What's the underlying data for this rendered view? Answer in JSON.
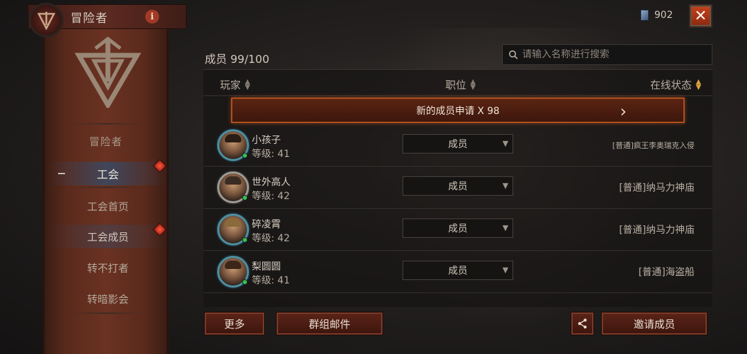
{
  "header": {
    "title": "冒险者",
    "info_icon": "info-icon"
  },
  "currency": {
    "icon": "gem-icon",
    "amount": "902"
  },
  "close_button": {
    "icon": "close-icon",
    "label": "✕"
  },
  "sidebar": {
    "caption": "冒险者",
    "items": [
      {
        "label": "工会",
        "state": "active",
        "badge": true
      },
      {
        "label": "工会首页",
        "state": "normal",
        "badge": false
      },
      {
        "label": "工会成员",
        "state": "selected",
        "badge": true
      },
      {
        "label": "转不打者",
        "state": "normal",
        "badge": false
      },
      {
        "label": "转暗影会",
        "state": "normal",
        "badge": false
      }
    ]
  },
  "members": {
    "count_label": "成员 99/100",
    "search_placeholder": "请输入名称进行搜索",
    "columns": {
      "player": "玩家",
      "role": "职位",
      "status": "在线状态"
    },
    "request_label": "新的成员申请 X 98",
    "rows": [
      {
        "name": "小孩子",
        "level": "等级: 41",
        "role": "成员",
        "status": "[普通]疯王李奥瑞克入侵",
        "status_small": true
      },
      {
        "name": "世外高人",
        "level": "等级: 42",
        "role": "成员",
        "status": "[普通]纳马力神庙",
        "status_small": false
      },
      {
        "name": "碎凌霄",
        "level": "等级: 42",
        "role": "成员",
        "status": "[普通]纳马力神庙",
        "status_small": false
      },
      {
        "name": "梨圆圆",
        "level": "等级: 41",
        "role": "成员",
        "status": "[普通]海盗船",
        "status_small": false
      }
    ]
  },
  "buttons": {
    "more": "更多",
    "group_mail": "群组邮件",
    "share_icon": "share-icon",
    "invite": "邀请成员"
  },
  "colors": {
    "accent_orange": "#b0501f",
    "banner_red": "#6a3222",
    "online_green": "#39c04a"
  }
}
